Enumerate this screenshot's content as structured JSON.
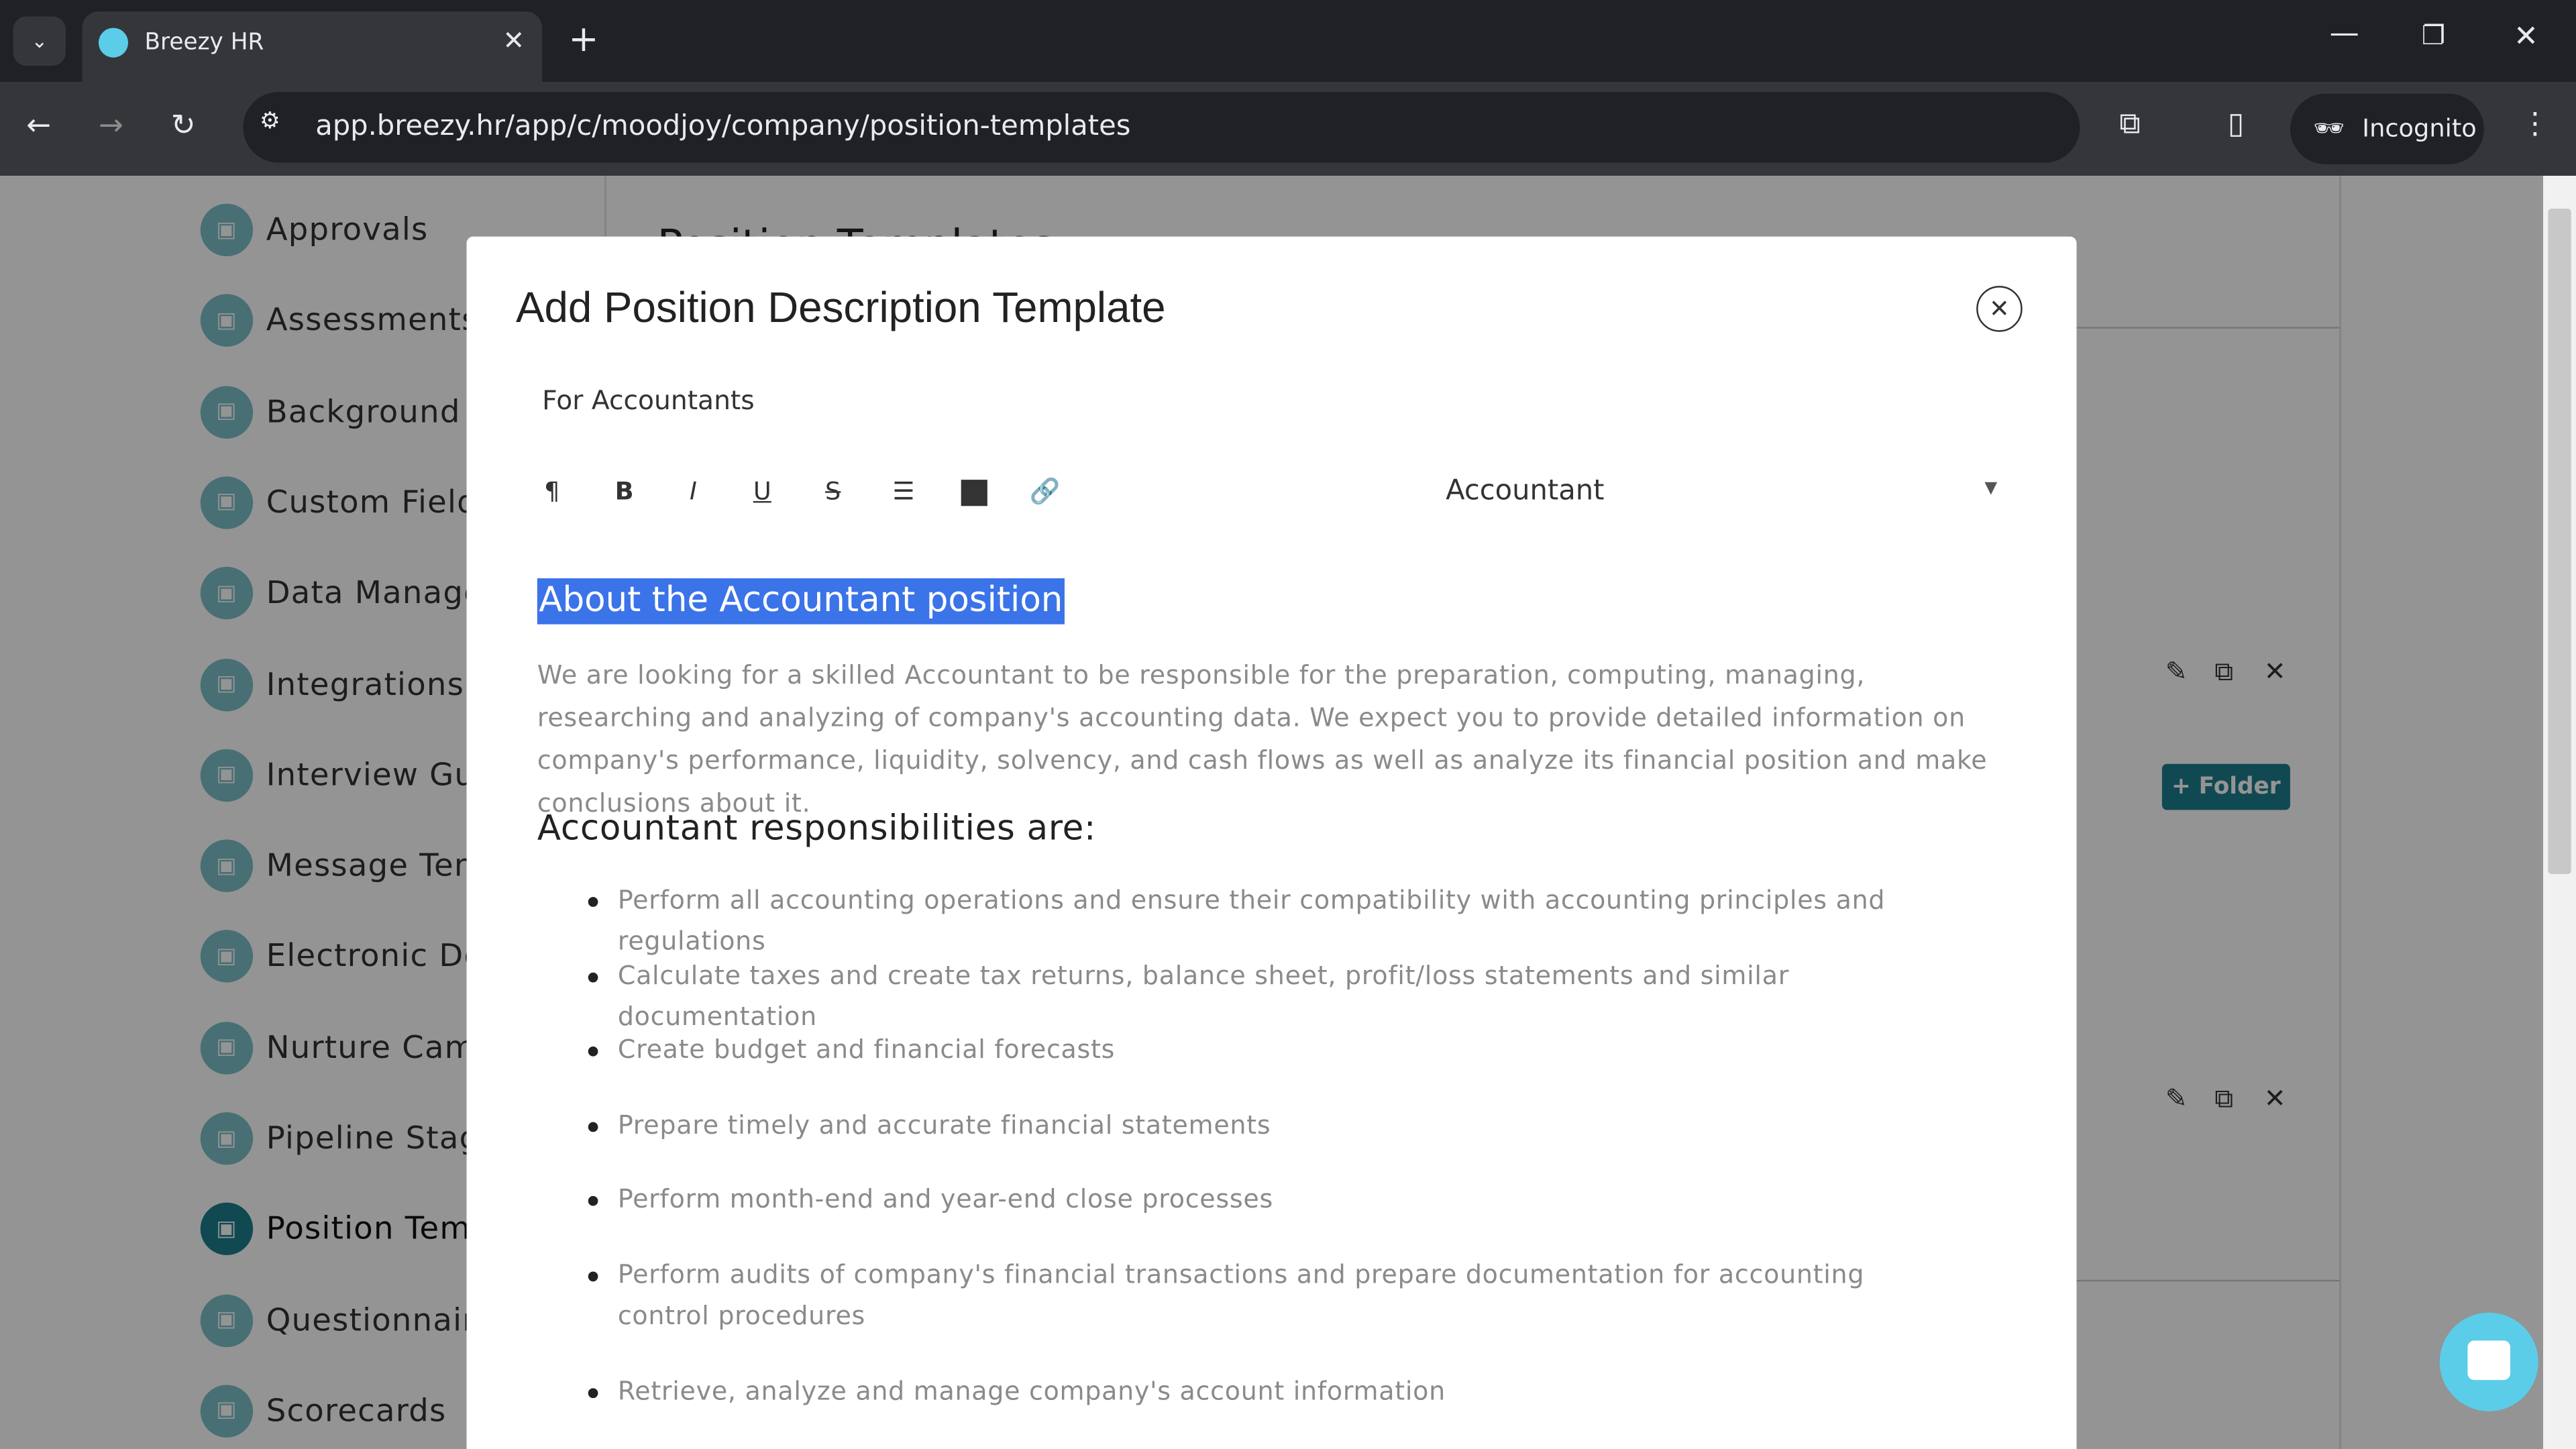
{
  "browser": {
    "tab_title": "Breezy HR",
    "url": "app.breezy.hr/app/c/moodjoy/company/position-templates",
    "profile": "Incognito"
  },
  "sidebar": {
    "items": [
      {
        "label": "Approvals",
        "icon": "shield-check-icon"
      },
      {
        "label": "Assessments",
        "icon": "shield-icon"
      },
      {
        "label": "Background C",
        "icon": "id-card-icon"
      },
      {
        "label": "Custom Fields",
        "icon": "table-icon"
      },
      {
        "label": "Data Manage",
        "icon": "tag-icon"
      },
      {
        "label": "Integrations",
        "icon": "cubes-icon"
      },
      {
        "label": "Interview Gui",
        "icon": "list-icon"
      },
      {
        "label": "Message Tem",
        "icon": "document-icon"
      },
      {
        "label": "Electronic Do",
        "icon": "signature-icon"
      },
      {
        "label": "Nurture Camp",
        "icon": "leaf-icon"
      },
      {
        "label": "Pipeline Stag",
        "icon": "columns-icon"
      },
      {
        "label": "Position Temp",
        "icon": "document-icon",
        "active": true
      },
      {
        "label": "Questionnaire",
        "icon": "list-icon"
      },
      {
        "label": "Scorecards",
        "icon": "thumbs-up-icon"
      }
    ]
  },
  "background": {
    "page_title": "Position Templates",
    "folder_button": "+ Folder"
  },
  "modal": {
    "title": "Add Position Description Template",
    "name_value": "For Accountants",
    "position_select": "Accountant",
    "toolbar": [
      "paragraph-icon",
      "bold-icon",
      "italic-icon",
      "underline-icon",
      "strikethrough-icon",
      "bullet-list-icon",
      "image-icon",
      "link-icon"
    ],
    "heading": "About the Accountant position",
    "intro": "We are looking for a skilled Accountant to be responsible for the preparation, computing, managing, researching and analyzing of company's accounting data. We expect you to provide detailed information on company's performance, liquidity, solvency, and cash flows as well as analyze its financial position and make conclusions about it.",
    "subheading": "Accountant responsibilities are:",
    "responsibilities": [
      "Perform all accounting operations and ensure their compatibility with accounting principles and regulations",
      "Calculate taxes and create tax returns, balance sheet, profit/loss statements and similar documentation",
      "Create budget and financial forecasts",
      "Prepare timely and accurate financial statements",
      "Perform month-end and year-end close processes",
      "Perform audits of company's financial transactions and prepare documentation for accounting control procedures",
      "Retrieve, analyze and manage company's account information"
    ]
  },
  "colors": {
    "accent": "#1c7f8e",
    "selection": "#3b73e8",
    "chat": "#5bcde8"
  }
}
